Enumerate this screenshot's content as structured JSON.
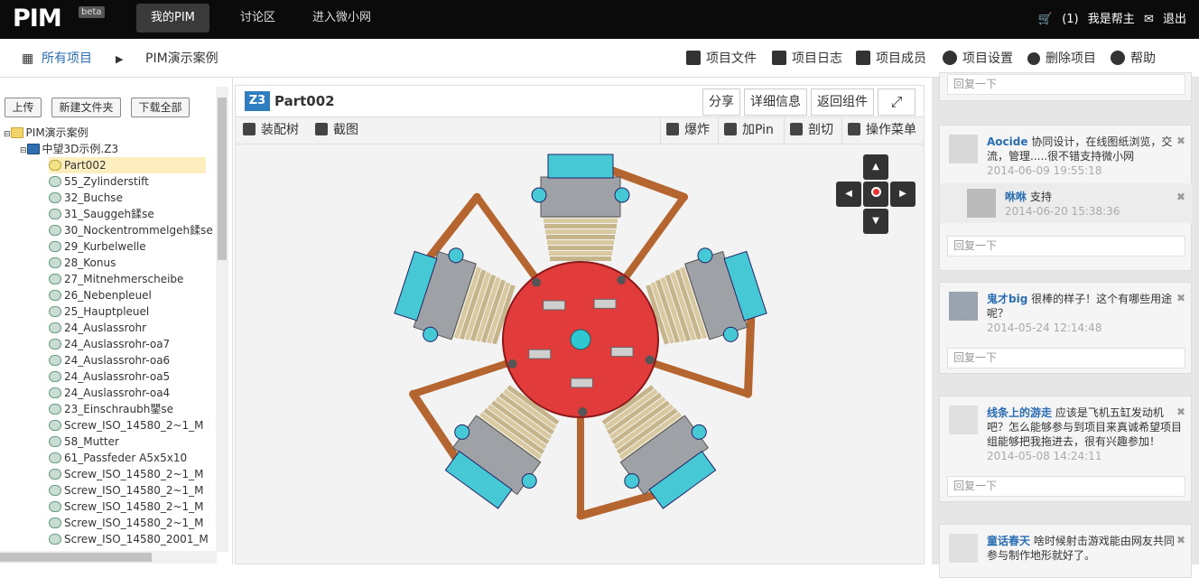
{
  "header": {
    "logo": "PIM",
    "beta": "beta",
    "nav": [
      "我的PIM",
      "讨论区",
      "进入微小网"
    ],
    "notifications": "(1)",
    "user": "我是帮主",
    "logout": "退出"
  },
  "subbar": {
    "crumb_root": "所有项目",
    "crumb_current": "PIM演示案例",
    "actions": [
      "项目文件",
      "项目日志",
      "项目成员",
      "项目设置",
      "删除项目",
      "帮助"
    ]
  },
  "left": {
    "buttons": [
      "上传",
      "新建文件夹",
      "下载全部"
    ],
    "root": "PIM演示案例",
    "assembly": "中望3D示例.Z3",
    "items": [
      "Part002",
      "55_Zylinderstift",
      "32_Buchse",
      "31_Sauggeh鍒se",
      "30_Nockentrommelgeh鍒se",
      "29_Kurbelwelle",
      "28_Konus",
      "27_Mitnehmerscheibe",
      "26_Nebenpleuel",
      "25_Hauptpleuel",
      "24_Auslassrohr",
      "24_Auslassrohr-oa7",
      "24_Auslassrohr-oa6",
      "24_Auslassrohr-oa5",
      "24_Auslassrohr-oa4",
      "23_Einschraubh鑍se",
      "Screw_ISO_14580_2~1_M",
      "58_Mutter",
      "61_Passfeder A5x5x10",
      "Screw_ISO_14580_2~1_M",
      "Screw_ISO_14580_2~1_M",
      "Screw_ISO_14580_2~1_M",
      "Screw_ISO_14580_2~1_M",
      "Screw_ISO_14580_2001_M"
    ]
  },
  "viewer": {
    "badge": "Z3",
    "title": "Part002",
    "buttons": [
      "分享",
      "详细信息",
      "返回组件"
    ],
    "toolbar_left": [
      "装配树",
      "截图"
    ],
    "toolbar_right": [
      "爆炸",
      "加Pin",
      "剖切",
      "操作菜单"
    ]
  },
  "comments": {
    "reply_placeholder": "回复一下",
    "items": [
      {
        "name": "Aocide",
        "text": "协同设计，在线图纸浏览，交流，管理.....很不错支持微小网",
        "time": "2014-06-09 19:55:18",
        "sub": {
          "name": "咻咻",
          "text": "支持",
          "time": "2014-06-20 15:38:36"
        }
      },
      {
        "name": "鬼才big",
        "text": "很棒的样子！这个有哪些用途呢？",
        "time": "2014-05-24 12:14:48"
      },
      {
        "name": "线条上的游走",
        "text": "应该是飞机五缸发动机吧？怎么能够参与到项目来真诚希望项目组能够把我拖进去，很有兴趣参加！",
        "time": "2014-05-08 14:24:11"
      },
      {
        "name": "童话春天",
        "text": "啥时候射击游戏能由网友共同参与制作地形就好了。"
      }
    ]
  }
}
